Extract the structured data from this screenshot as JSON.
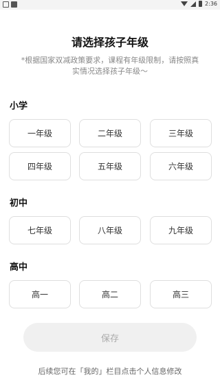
{
  "status_bar": {
    "time": "2:36"
  },
  "header": {
    "title": "请选择孩子年级",
    "subtitle": "*根据国家双减政策要求，课程有年级限制，请按照真实情况选择孩子年级～"
  },
  "sections": {
    "primary": {
      "label": "小学",
      "grades": [
        "一年级",
        "二年级",
        "三年级",
        "四年级",
        "五年级",
        "六年级"
      ]
    },
    "junior": {
      "label": "初中",
      "grades": [
        "七年级",
        "八年级",
        "九年级"
      ]
    },
    "senior": {
      "label": "高中",
      "grades": [
        "高一",
        "高二",
        "高三"
      ]
    }
  },
  "save_label": "保存",
  "footer_tip": "后续您可在「我的」栏目点击个人信息修改"
}
